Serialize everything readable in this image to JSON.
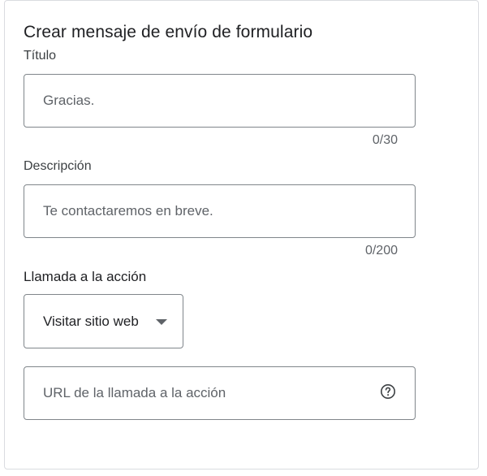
{
  "form": {
    "heading": "Crear mensaje de envío de formulario",
    "title_label": "Título",
    "title_placeholder": "Gracias.",
    "title_counter": "0/30",
    "description_label": "Descripción",
    "description_placeholder": "Te contactaremos en breve.",
    "description_counter": "0/200",
    "cta_label": "Llamada a la acción",
    "cta_selected": "Visitar sitio web",
    "url_placeholder": "URL de la llamada a la acción"
  },
  "icons": {
    "dropdown": "chevron-down-icon",
    "help": "help-circle-icon"
  }
}
